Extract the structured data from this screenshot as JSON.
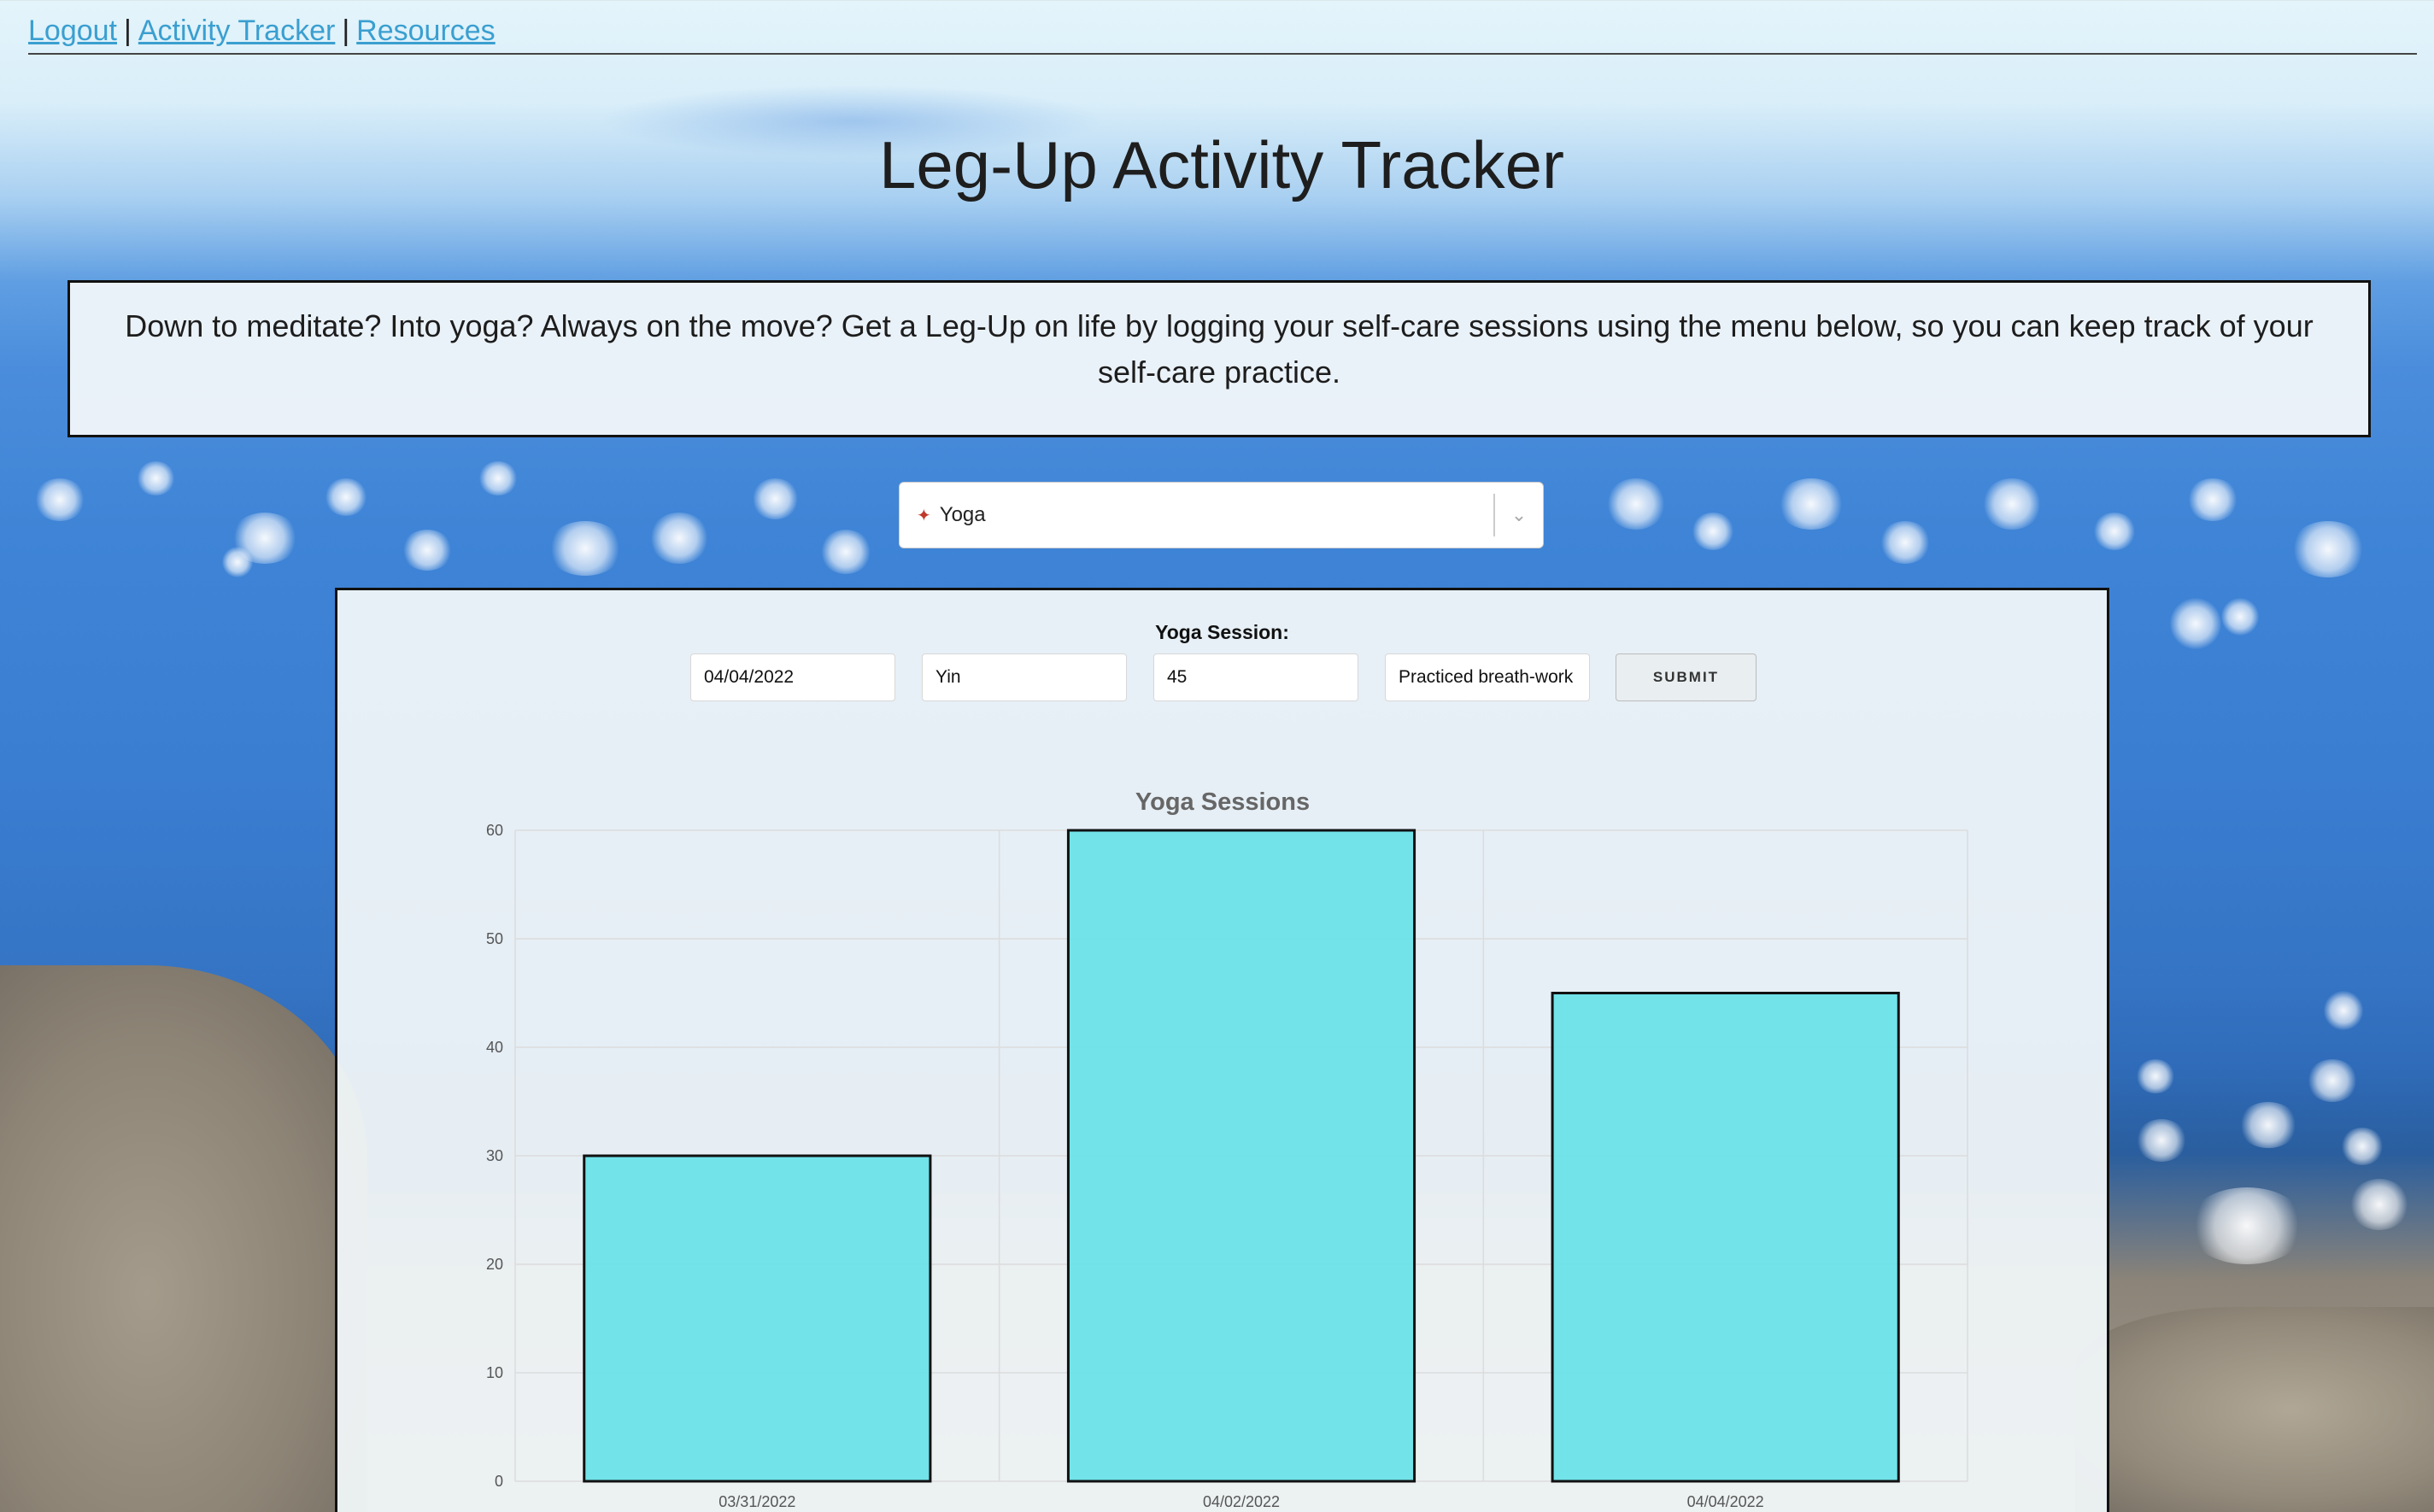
{
  "nav": {
    "logout": "Logout",
    "activity_tracker": "Activity Tracker",
    "resources": "Resources",
    "separator": "|"
  },
  "page": {
    "title": "Leg-Up Activity Tracker",
    "intro": "Down to meditate? Into yoga? Always on the move? Get a Leg-Up on life by logging your self-care sessions using the menu below, so you can keep track of your self-care practice."
  },
  "activity_select": {
    "icon": "yoga-pose-icon",
    "value": "Yoga"
  },
  "form": {
    "label": "Yoga Session:",
    "date": "04/04/2022",
    "type": "Yin",
    "duration": "45",
    "notes": "Practiced breath-work",
    "submit": "SUBMIT"
  },
  "colors": {
    "bar_fill": "#6ae2e8",
    "bar_stroke": "#111111",
    "link": "#3a9fd0"
  },
  "chart_data": {
    "type": "bar",
    "title": "Yoga Sessions",
    "categories": [
      "03/31/2022",
      "04/02/2022",
      "04/04/2022"
    ],
    "values": [
      30,
      60,
      45
    ],
    "ylim": [
      0,
      60
    ],
    "yticks": [
      0,
      10,
      20,
      30,
      40,
      50,
      60
    ],
    "grid": true,
    "xlabel": "",
    "ylabel": ""
  }
}
